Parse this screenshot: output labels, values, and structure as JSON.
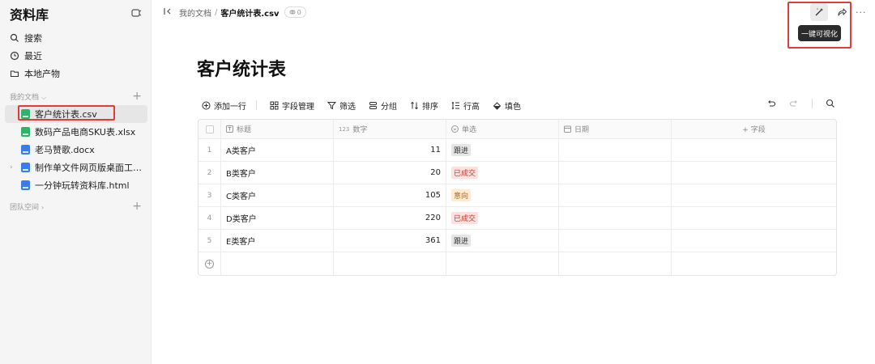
{
  "sidebar": {
    "title": "资料库",
    "nav": [
      {
        "icon": "search-icon",
        "label": "搜索"
      },
      {
        "icon": "clock-icon",
        "label": "最近"
      },
      {
        "icon": "folder-icon",
        "label": "本地产物"
      }
    ],
    "my_docs_label": "我的文档",
    "team_label": "团队空间",
    "files": [
      {
        "name": "客户统计表.csv",
        "type": "csv",
        "active": true
      },
      {
        "name": "数码产品电商SKU表.xlsx",
        "type": "xlsx"
      },
      {
        "name": "老马赞歌.docx",
        "type": "docx"
      },
      {
        "name": "制作单文件网页版桌面工作台....",
        "type": "html",
        "expandable": true
      },
      {
        "name": "一分钟玩转资料库.html",
        "type": "html"
      }
    ]
  },
  "topbar": {
    "breadcrumb_parent": "我的文档",
    "breadcrumb_sep": "/",
    "breadcrumb_current": "客户统计表.csv",
    "link_count": "0",
    "tooltip": "一键可视化",
    "more": "···"
  },
  "page": {
    "title": "客户统计表"
  },
  "toolbar": {
    "add_row": "添加一行",
    "field_manage": "字段管理",
    "filter": "筛选",
    "group": "分组",
    "sort": "排序",
    "row_height": "行高",
    "fill_color": "填色"
  },
  "table": {
    "columns": [
      {
        "icon": "text-field-icon",
        "label": "标题"
      },
      {
        "icon": "number-field-icon",
        "icon_text": "123",
        "label": "数字"
      },
      {
        "icon": "single-select-icon",
        "label": "单选"
      },
      {
        "icon": "date-field-icon",
        "label": "日期"
      },
      {
        "label": "+ 字段"
      }
    ],
    "rows": [
      {
        "index": "1",
        "title": "A类客户",
        "number": "11",
        "status": "跟进",
        "status_color": "gray"
      },
      {
        "index": "2",
        "title": "B类客户",
        "number": "20",
        "status": "已成交",
        "status_color": "red"
      },
      {
        "index": "3",
        "title": "C类客户",
        "number": "105",
        "status": "意向",
        "status_color": "orange"
      },
      {
        "index": "4",
        "title": "D类客户",
        "number": "220",
        "status": "已成交",
        "status_color": "red"
      },
      {
        "index": "5",
        "title": "E类客户",
        "number": "361",
        "status": "跟进",
        "status_color": "gray"
      }
    ]
  },
  "colors": {
    "highlight_red": "#e43a3a",
    "csv_green": "#2fb36a",
    "doc_blue": "#3b7bf0",
    "tooltip_bg": "#2b2b2b"
  }
}
